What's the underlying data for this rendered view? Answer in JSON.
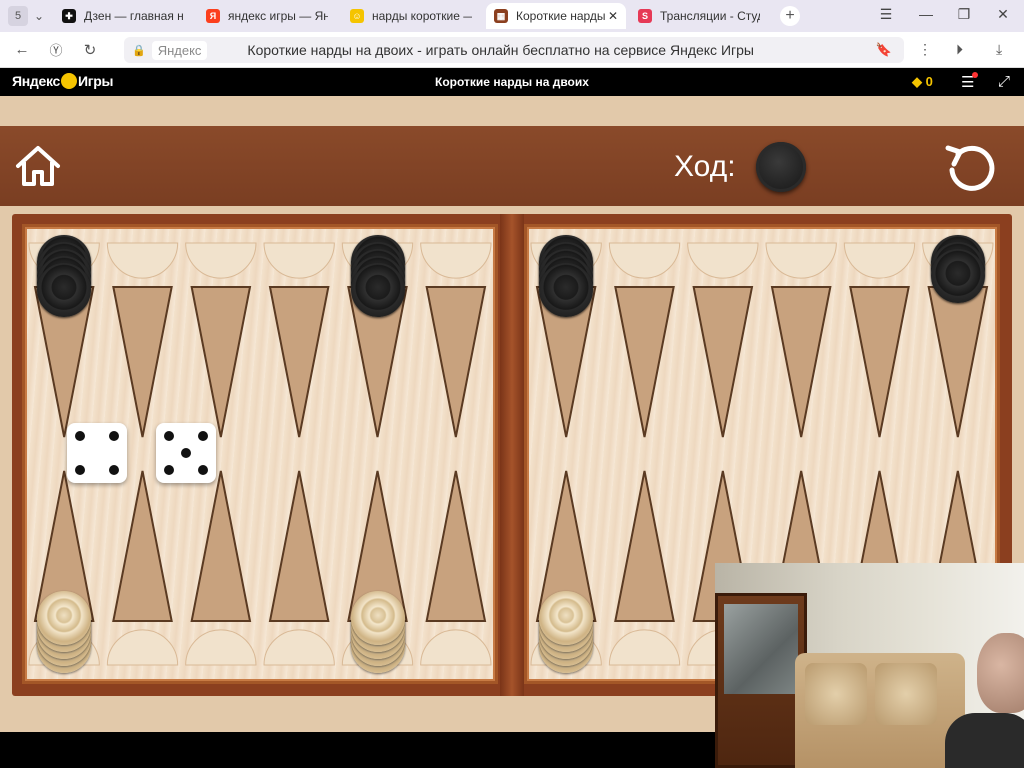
{
  "browser": {
    "tab_count": "5",
    "tabs": [
      {
        "label": "Дзен — главная нов",
        "fav_color": "#111111",
        "fav_glyph": "✚"
      },
      {
        "label": "яндекс игры — Янд",
        "fav_color": "#fc3f1d",
        "fav_glyph": "Я"
      },
      {
        "label": "нарды короткие — ",
        "fav_color": "#f5c400",
        "fav_glyph": "☺"
      },
      {
        "label": "Короткие нарды",
        "fav_color": "#8b3f1f",
        "fav_glyph": "▦",
        "active": true
      },
      {
        "label": "Трансляции - Студ",
        "fav_color": "#e63956",
        "fav_glyph": "S"
      }
    ],
    "address": {
      "host": "Яндекс",
      "page_title": "Короткие нарды на двоих - играть онлайн бесплатно на сервисе Яндекс Игры"
    }
  },
  "yandex_bar": {
    "logo_left": "Яндекс",
    "logo_right": "Игры",
    "title": "Короткие нарды на двоих",
    "coins": "0"
  },
  "game": {
    "turn_label": "Ход:",
    "turn_color": "black",
    "dice": [
      4,
      5
    ],
    "colors": {
      "frame": "#8b3f1f",
      "header": "#7a3e22",
      "dark_point": "#c8a27e",
      "light_point": "#f1e2cc"
    },
    "checkers": {
      "top_left_point1": {
        "color": "black",
        "count": 5
      },
      "top_left_point5": {
        "color": "black",
        "count": 5
      },
      "top_right_point1": {
        "color": "black",
        "count": 5
      },
      "top_right_point6": {
        "color": "black",
        "count": 3
      },
      "bottom_left_point1": {
        "color": "white",
        "count": 5
      },
      "bottom_left_point5": {
        "color": "white",
        "count": 5
      },
      "bottom_right_point1": {
        "color": "white",
        "count": 5
      }
    }
  }
}
